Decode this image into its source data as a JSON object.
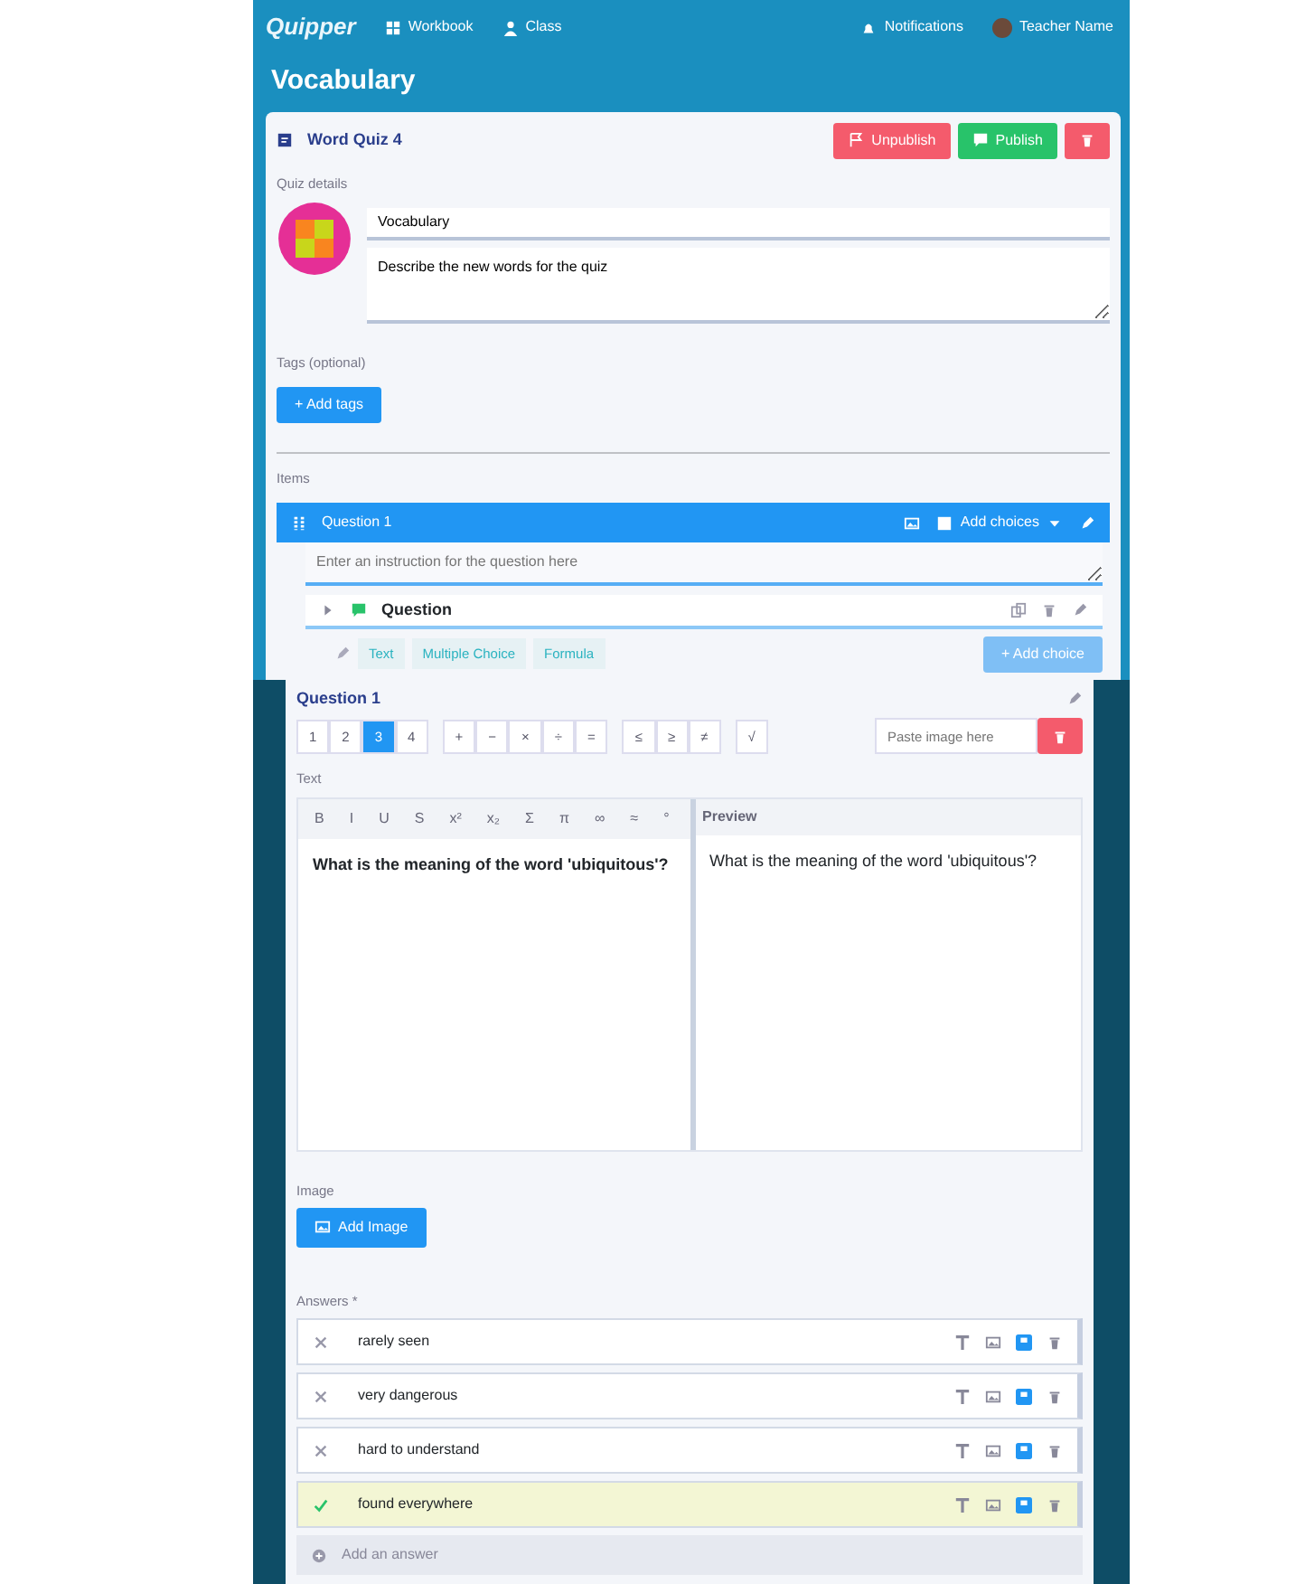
{
  "navbar": {
    "logo": "Quipper",
    "links": [
      {
        "label": "Workbook",
        "kind": "grid"
      },
      {
        "label": "Class",
        "kind": "person"
      }
    ],
    "notifications": "Notifications",
    "user": "Teacher Name"
  },
  "page_title": "Vocabulary",
  "quiz": {
    "title": "Word Quiz 4",
    "buttons": [
      {
        "kind": "unpublish",
        "label": "Unpublish"
      },
      {
        "kind": "publish",
        "label": "Publish"
      },
      {
        "kind": "delete"
      }
    ],
    "details_label": "Quiz details",
    "name_value": "Vocabulary",
    "description_value": "Describe the new words for the quiz",
    "tags_label": "Tags (optional)",
    "add_tags_button": "+ Add tags",
    "items_label": "Items",
    "question_header": {
      "title": "Question 1",
      "menu": "Add choices"
    },
    "instruction_placeholder": "Enter an instruction for the question here",
    "question_row": {
      "label": "Question",
      "expanded": false
    },
    "type_tabs": [
      "Text",
      "Multiple Choice",
      "Formula"
    ],
    "add_choice_button": "+ Add choice"
  },
  "editor": {
    "title": "Question 1",
    "pages": [
      {
        "label": "1",
        "selected": false
      },
      {
        "label": "2",
        "selected": false
      },
      {
        "label": "3",
        "selected": true
      },
      {
        "label": "4",
        "selected": false
      }
    ],
    "symbol_groups": [
      [
        "+",
        "−",
        "×",
        "÷",
        "="
      ],
      [
        "≤",
        "≥",
        "≠"
      ],
      [
        "√"
      ]
    ],
    "image_placeholder": "Paste image here",
    "text_label": "Text",
    "toolbar": [
      "B",
      "I",
      "U",
      "S",
      "x²",
      "x₂",
      "Σ",
      "π",
      "∞",
      "≈",
      "°"
    ],
    "preview_label": "Preview",
    "preview_text": "What is the meaning of the word 'ubiquitous'?",
    "editor_text": "What is the meaning of the word 'ubiquitous'?",
    "image_label": "Image",
    "add_image_button": "Add Image",
    "answers_label": "Answers *",
    "answers": [
      {
        "text": "rarely seen",
        "correct": false
      },
      {
        "text": "very dangerous",
        "correct": false
      },
      {
        "text": "hard to understand",
        "correct": false
      },
      {
        "text": "found everywhere",
        "correct": true
      }
    ],
    "add_answer": "Add an answer"
  }
}
